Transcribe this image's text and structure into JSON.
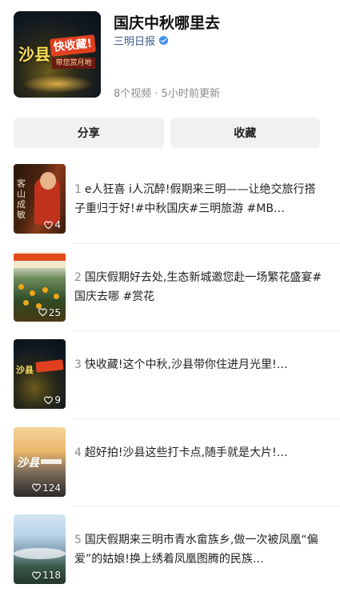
{
  "collection": {
    "title": "国庆中秋哪里去",
    "author": "三明日报",
    "meta": "8个视频 · 5小时前更新",
    "cover_text": [
      "沙县",
      "快收藏!",
      "带您赏月地"
    ]
  },
  "actions": {
    "share_label": "分享",
    "favorite_label": "收藏"
  },
  "items": [
    {
      "index": "1",
      "text": "e人狂喜 i人沉醉!假期来三明——让绝交旅行搭子重归于好!#中秋国庆#三明旅游 #MB…",
      "likes": "4",
      "thumb_text": "客山成敏"
    },
    {
      "index": "2",
      "text": "国庆假期好去处,生态新城邀您赴一场繁花盛宴#国庆去哪 #赏花",
      "likes": "25"
    },
    {
      "index": "3",
      "text": "快收藏!这个中秋,沙县带你住进月光里!…",
      "likes": "9",
      "thumb_text": "沙县"
    },
    {
      "index": "4",
      "text": "超好拍!沙县这些打卡点,随手就是大片!…",
      "likes": "124",
      "thumb_text": "沙县"
    },
    {
      "index": "5",
      "text": "国庆假期来三明市青水畲族乡,做一次被凤凰“偏爱”的姑娘!换上绣着凤凰图腾的民族…",
      "likes": "118"
    }
  ]
}
